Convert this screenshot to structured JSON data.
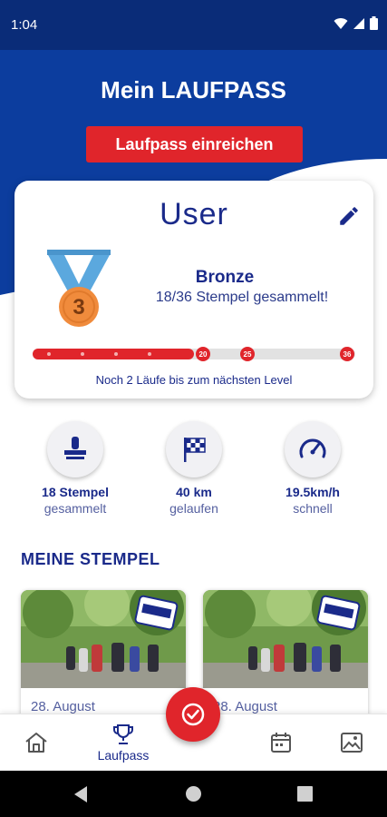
{
  "status_bar": {
    "time": "1:04"
  },
  "header": {
    "title": "Mein LAUFPASS",
    "submit_label": "Laufpass einreichen"
  },
  "card": {
    "user_name": "User",
    "medal_number": "3",
    "level_name": "Bronze",
    "stamps_progress": "18/36 Stempel gesammelt!",
    "progress_fraction": 0.5,
    "milestones": [
      "20",
      "25",
      "36"
    ],
    "progress_note": "Noch 2 Läufe bis zum nächsten Level"
  },
  "stats": [
    {
      "value": "18 Stempel",
      "label": "gesammelt",
      "icon": "stamp-icon"
    },
    {
      "value": "40 km",
      "label": "gelaufen",
      "icon": "checkered-flag-icon"
    },
    {
      "value": "19.5km/h",
      "label": "schnell",
      "icon": "speedometer-icon"
    }
  ],
  "stamps_section": {
    "title": "MEINE STEMPEL",
    "items": [
      {
        "date": "28. August"
      },
      {
        "date": "28. August"
      }
    ]
  },
  "bottom_nav": {
    "items": [
      {
        "icon": "home-icon",
        "label": ""
      },
      {
        "icon": "trophy-icon",
        "label": "Laufpass"
      },
      {
        "icon": "calendar-icon",
        "label": ""
      },
      {
        "icon": "image-icon",
        "label": ""
      }
    ],
    "fab_icon": "check-circle-icon"
  },
  "colors": {
    "primary_blue": "#0c3d9e",
    "accent_red": "#e0252b",
    "text_navy": "#1a2a8a"
  }
}
